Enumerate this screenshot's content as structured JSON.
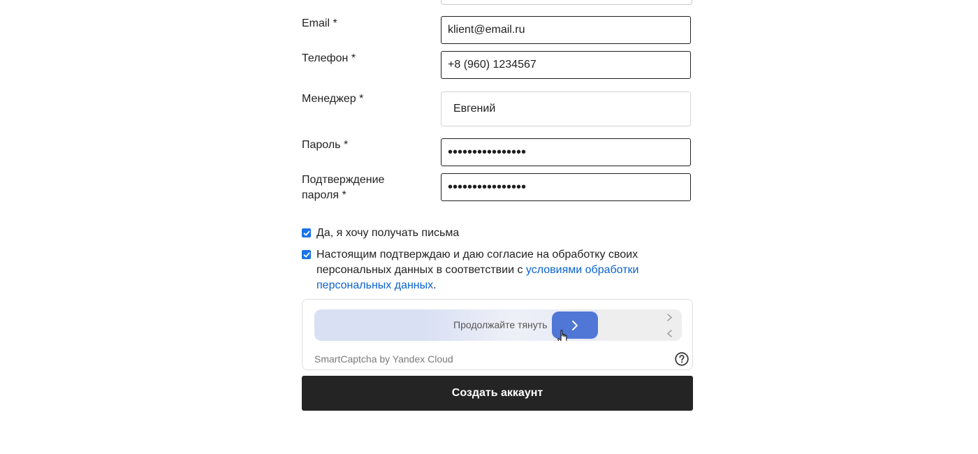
{
  "form": {
    "fields": [
      {
        "label": "Email *",
        "value": "klient@email.ru"
      },
      {
        "label": "Телефон *",
        "value": "+8 (960) 1234567"
      },
      {
        "label": "Менеджер *",
        "value": "Евгений"
      },
      {
        "label": "Пароль *",
        "value": "••••••••••••••••"
      },
      {
        "label_line1": "Подтверждение",
        "label_line2": "пароля *",
        "value": "••••••••••••••••"
      }
    ],
    "checkboxes": [
      {
        "text": "Да, я хочу получать письма",
        "checked": true
      },
      {
        "text_before": "Настоящим подтверждаю и даю согласие на обработку своих персональных данных в соответствии с ",
        "link_text": "условиями обработки персональных данных",
        "text_after": ".",
        "checked": true
      }
    ],
    "submit_label": "Создать аккаунт"
  },
  "captcha": {
    "prompt": "Продолжайте тянуть",
    "brand": "SmartCaptcha by Yandex Cloud",
    "progress_fraction": 0.74,
    "help_icon": "question-circle-icon",
    "handle_icon": "chevron-right-icon"
  },
  "colors": {
    "accent": "#1a73e8",
    "link": "#0b63ce",
    "captcha_handle": "#5077d6",
    "submit_bg": "#242424"
  }
}
